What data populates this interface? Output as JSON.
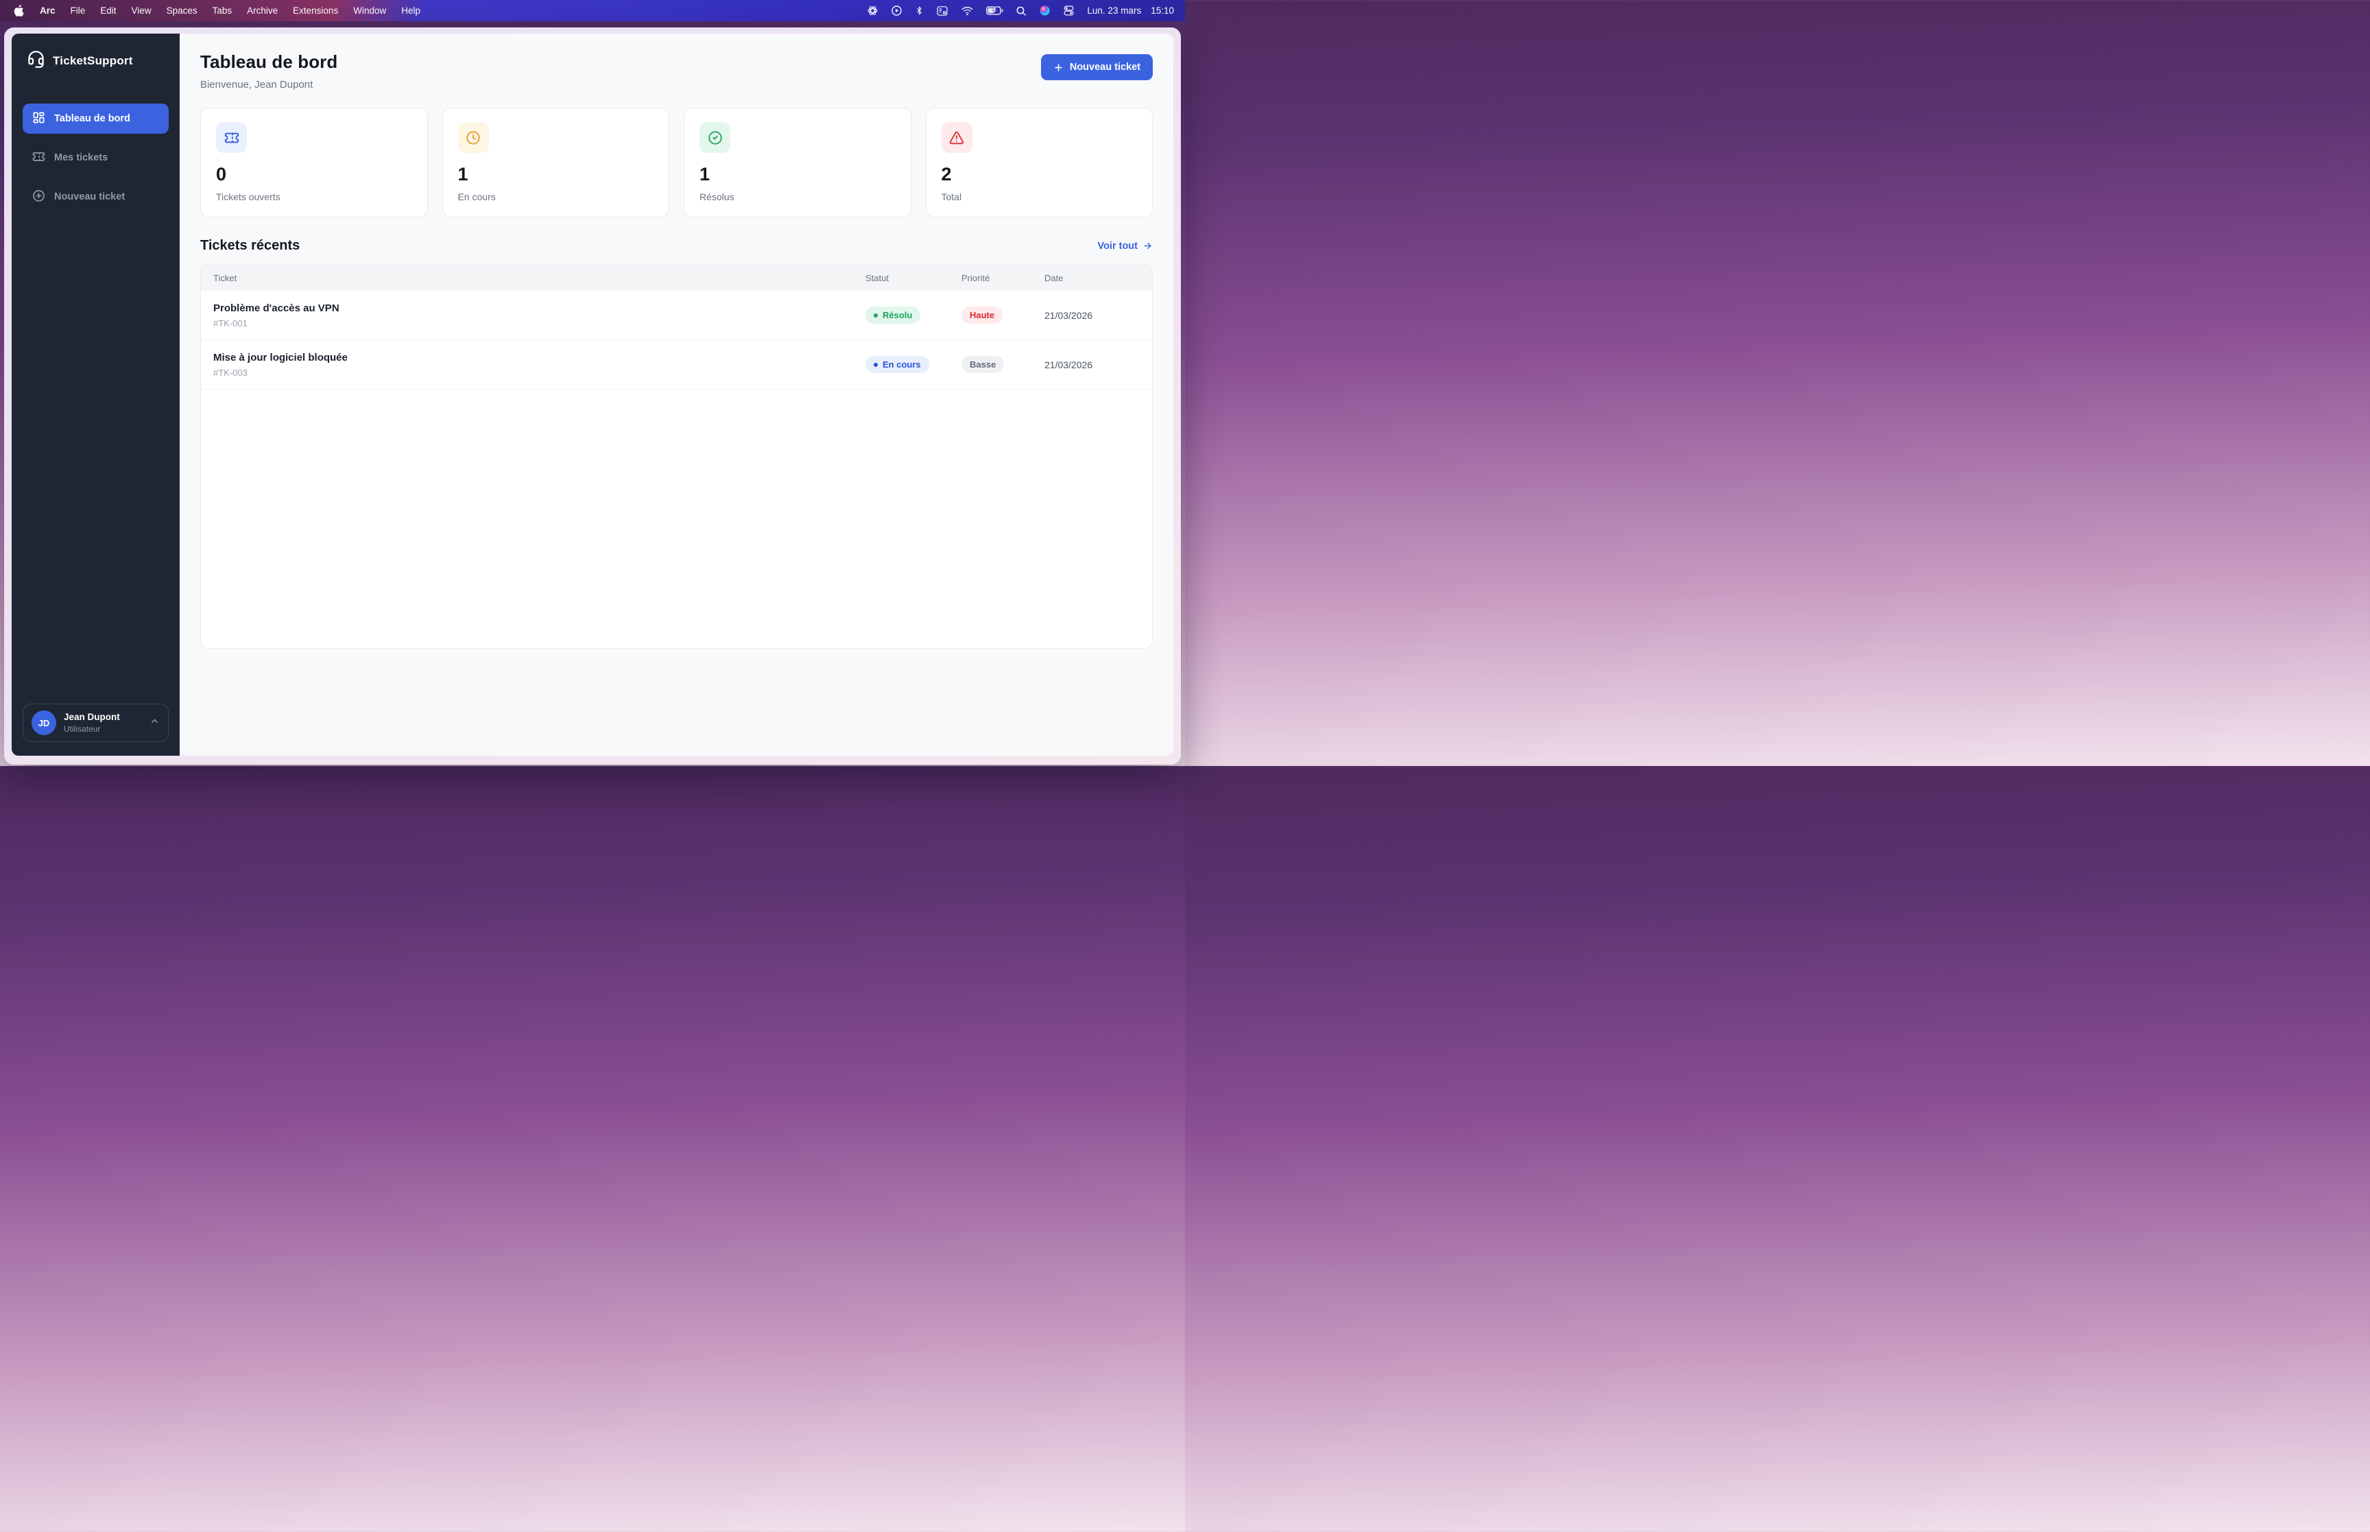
{
  "menubar": {
    "app_name": "Arc",
    "menus": [
      "File",
      "Edit",
      "View",
      "Spaces",
      "Tabs",
      "Archive",
      "Extensions",
      "Window",
      "Help"
    ],
    "status_icons": [
      "chatgpt-icon",
      "media-play-icon",
      "bluetooth-icon",
      "keyboard-icon",
      "wifi-icon",
      "battery-charging-icon",
      "spotlight-search-icon",
      "siri-icon",
      "control-center-icon"
    ],
    "date": "Lun. 23 mars",
    "time": "15:10"
  },
  "sidebar": {
    "brand": "TicketSupport",
    "items": [
      {
        "label": "Tableau de bord",
        "icon": "dashboard-icon",
        "active": true
      },
      {
        "label": "Mes tickets",
        "icon": "ticket-icon",
        "active": false
      },
      {
        "label": "Nouveau ticket",
        "icon": "plus-circle-icon",
        "active": false
      }
    ],
    "user": {
      "initials": "JD",
      "name": "Jean Dupont",
      "role": "Utilisateur"
    }
  },
  "header": {
    "title": "Tableau de bord",
    "subtitle": "Bienvenue, Jean Dupont",
    "new_ticket_label": "Nouveau ticket"
  },
  "stats": [
    {
      "value": "0",
      "label": "Tickets ouverts",
      "icon": "ticket-icon",
      "icon_color": "#3b63e0",
      "icon_bg": "#e9effc"
    },
    {
      "value": "1",
      "label": "En cours",
      "icon": "clock-icon",
      "icon_color": "#e5a33c",
      "icon_bg": "#fdf6e3"
    },
    {
      "value": "1",
      "label": "Résolus",
      "icon": "check-circle-icon",
      "icon_color": "#2fa968",
      "icon_bg": "#e3f6ec"
    },
    {
      "value": "2",
      "label": "Total",
      "icon": "alert-triangle-icon",
      "icon_color": "#dc3b40",
      "icon_bg": "#fdeaea"
    }
  ],
  "recent": {
    "title": "Tickets récents",
    "view_all": "Voir tout",
    "columns": [
      "Ticket",
      "Statut",
      "Priorité",
      "Date"
    ],
    "rows": [
      {
        "title": "Problème d'accès au VPN",
        "id": "#TK-001",
        "status": "Résolu",
        "status_type": "resolved",
        "priority": "Haute",
        "priority_type": "high",
        "date": "21/03/2026"
      },
      {
        "title": "Mise à jour logiciel bloquée",
        "id": "#TK-003",
        "status": "En cours",
        "status_type": "progress",
        "priority": "Basse",
        "priority_type": "low",
        "date": "21/03/2026"
      }
    ]
  },
  "colors": {
    "accent": "#3b63e0",
    "sidebar_bg": "#1f2633",
    "main_bg": "#f8f9fb",
    "status_resolved": "#18a45c",
    "status_progress": "#2b53d8",
    "priority_high": "#d92d32",
    "priority_low": "#636b78"
  }
}
